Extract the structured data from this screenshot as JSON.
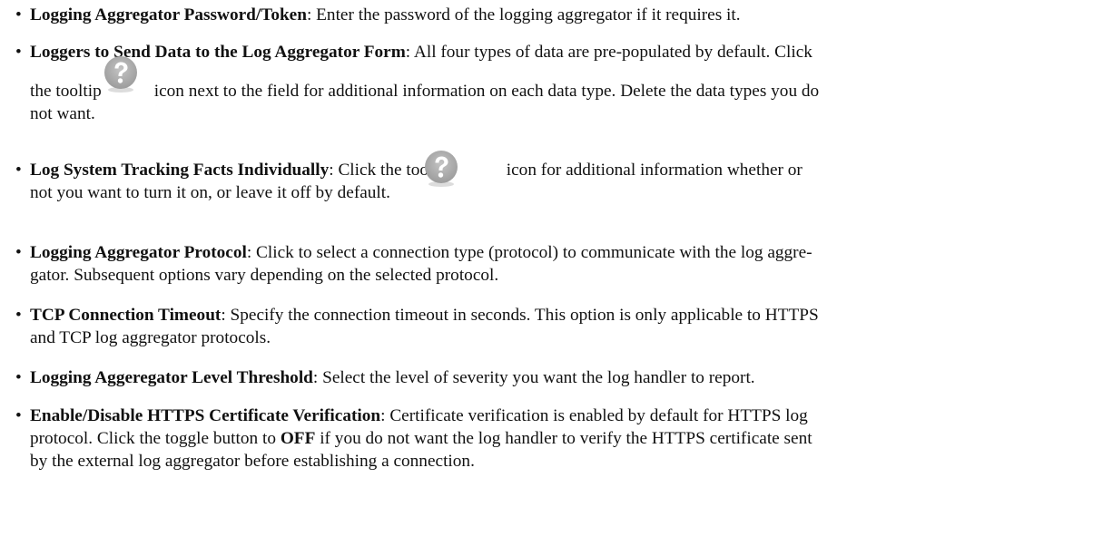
{
  "items": [
    {
      "term": "Logging Aggregator Password/Token",
      "desc": ": Enter the password of the logging aggregator if it requires it."
    },
    {
      "term": "Loggers to Send Data to the Log Aggregator Form",
      "desc_a": ": All four types of data are pre-populated by default. Click",
      "desc_b": "the tooltip",
      "desc_c": "icon next to the field for additional information on each data type. Delete the data types you do",
      "desc_d": "not want."
    },
    {
      "term": "Log System Tracking Facts Individually",
      "desc_a": ": Click the tooltip",
      "desc_b": "icon for additional information whether or",
      "desc_c": "not you want to turn it on, or leave it off by default."
    },
    {
      "term": "Logging Aggregator Protocol",
      "desc_a": ": Click to select a connection type (protocol) to communicate with the log aggre-",
      "desc_b": "gator. Subsequent options vary depending on the selected protocol."
    },
    {
      "term": "TCP Connection Timeout",
      "desc_a": ": Specify the connection timeout in seconds. This option is only applicable to HTTPS",
      "desc_b": "and TCP log aggregator protocols."
    },
    {
      "term": "Logging Aggeregator Level Threshold",
      "desc": ": Select the level of severity you want the log handler to report."
    },
    {
      "term": "Enable/Disable HTTPS Certificate Verification",
      "desc_a": ": Certificate verification is enabled by default for HTTPS log",
      "desc_b": "protocol. Click the toggle button to",
      "desc_b_bold": "OFF",
      "desc_b2": "if you do not want the log handler to verify the HTTPS certificate sent",
      "desc_c": "by the external log aggregator before establishing a connection."
    }
  ],
  "bullet_char": "•",
  "icons": {
    "tooltip": "question-mark-icon",
    "tooltip_color": "#a8a8a8"
  }
}
